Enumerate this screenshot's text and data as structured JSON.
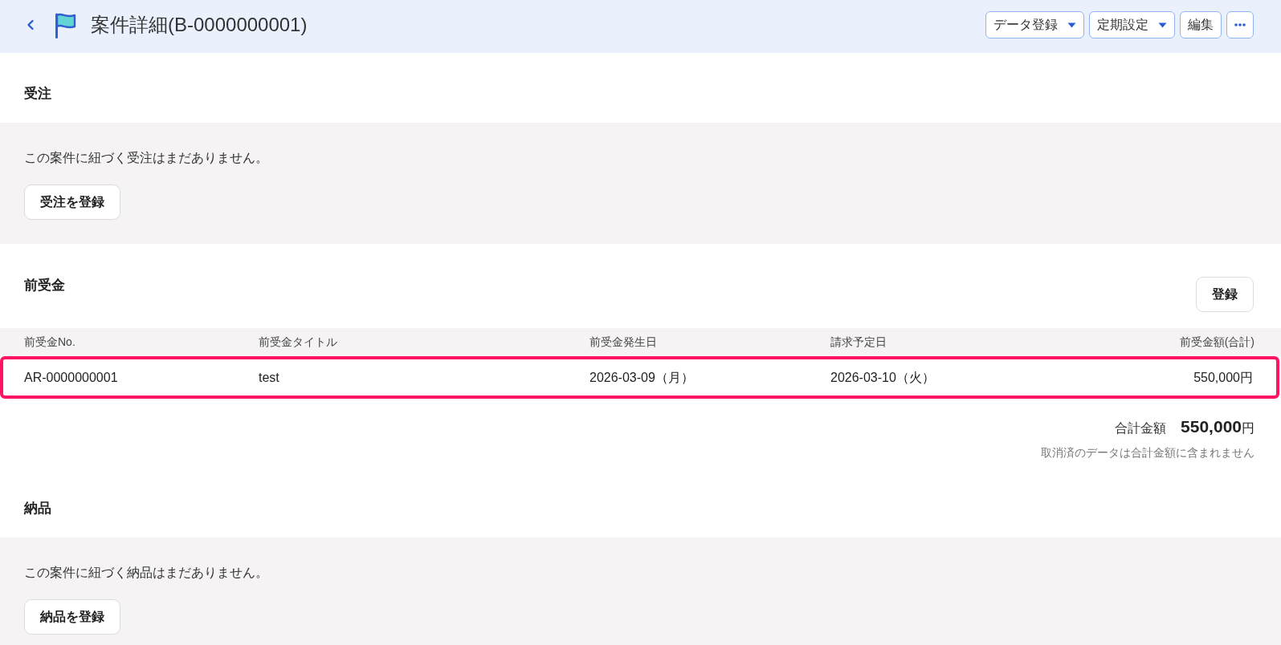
{
  "header": {
    "title": "案件詳細(B-0000000001)",
    "actions": [
      {
        "kind": "dropdown",
        "label": "データ登録"
      },
      {
        "kind": "dropdown",
        "label": "定期設定"
      },
      {
        "kind": "button",
        "label": "編集"
      },
      {
        "kind": "more"
      }
    ]
  },
  "sections": [
    {
      "kind": "empty",
      "title": "受注",
      "message": "この案件に紐づく受注はまだありません。",
      "button": "受注を登録"
    },
    {
      "kind": "table",
      "title": "前受金",
      "button": "登録",
      "table": {
        "columns": [
          "前受金No.",
          "前受金タイトル",
          "前受金発生日",
          "請求予定日",
          "前受金額(合計)"
        ],
        "rows": [
          {
            "highlighted": true,
            "cells": [
              "AR-0000000001",
              "test",
              "2026-03-09（月）",
              "2026-03-10（火）",
              "550,000円"
            ]
          }
        ]
      },
      "total": {
        "label": "合計金額",
        "amount": "550,000",
        "unit": "円"
      },
      "note": "取消済のデータは合計金額に含まれません"
    },
    {
      "kind": "empty",
      "title": "納品",
      "message": "この案件に紐づく納品はまだありません。",
      "button": "納品を登録"
    }
  ]
}
